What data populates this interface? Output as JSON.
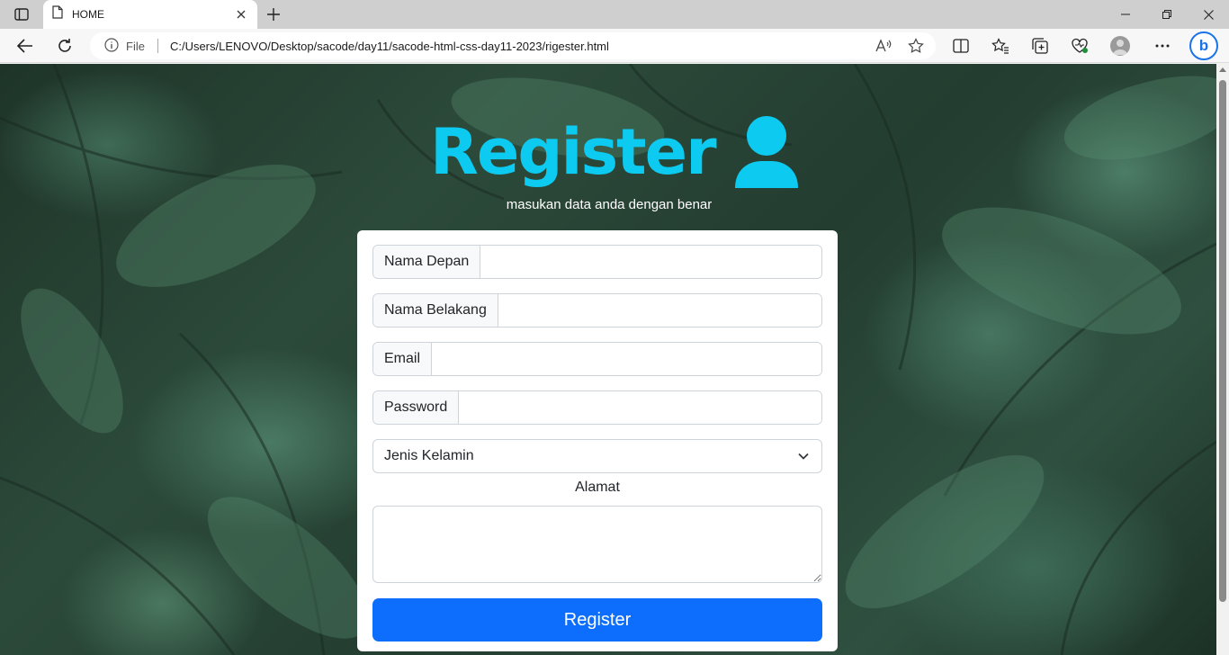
{
  "browser": {
    "tab_title": "HOME",
    "site_info_label": "File",
    "url": "C:/Users/LENOVO/Desktop/sacode/day11/sacode-html-css-day11-2023/rigester.html",
    "bing_label": "b"
  },
  "page": {
    "title": "Register",
    "subtitle": "masukan data anda dengan benar",
    "form": {
      "first_name_label": "Nama Depan",
      "last_name_label": "Nama Belakang",
      "email_label": "Email",
      "password_label": "Password",
      "gender_select_value": "Jenis Kelamin",
      "address_label": "Alamat",
      "submit_label": "Register"
    },
    "colors": {
      "title": "#0dcaf0",
      "button": "#0d6efd"
    }
  }
}
